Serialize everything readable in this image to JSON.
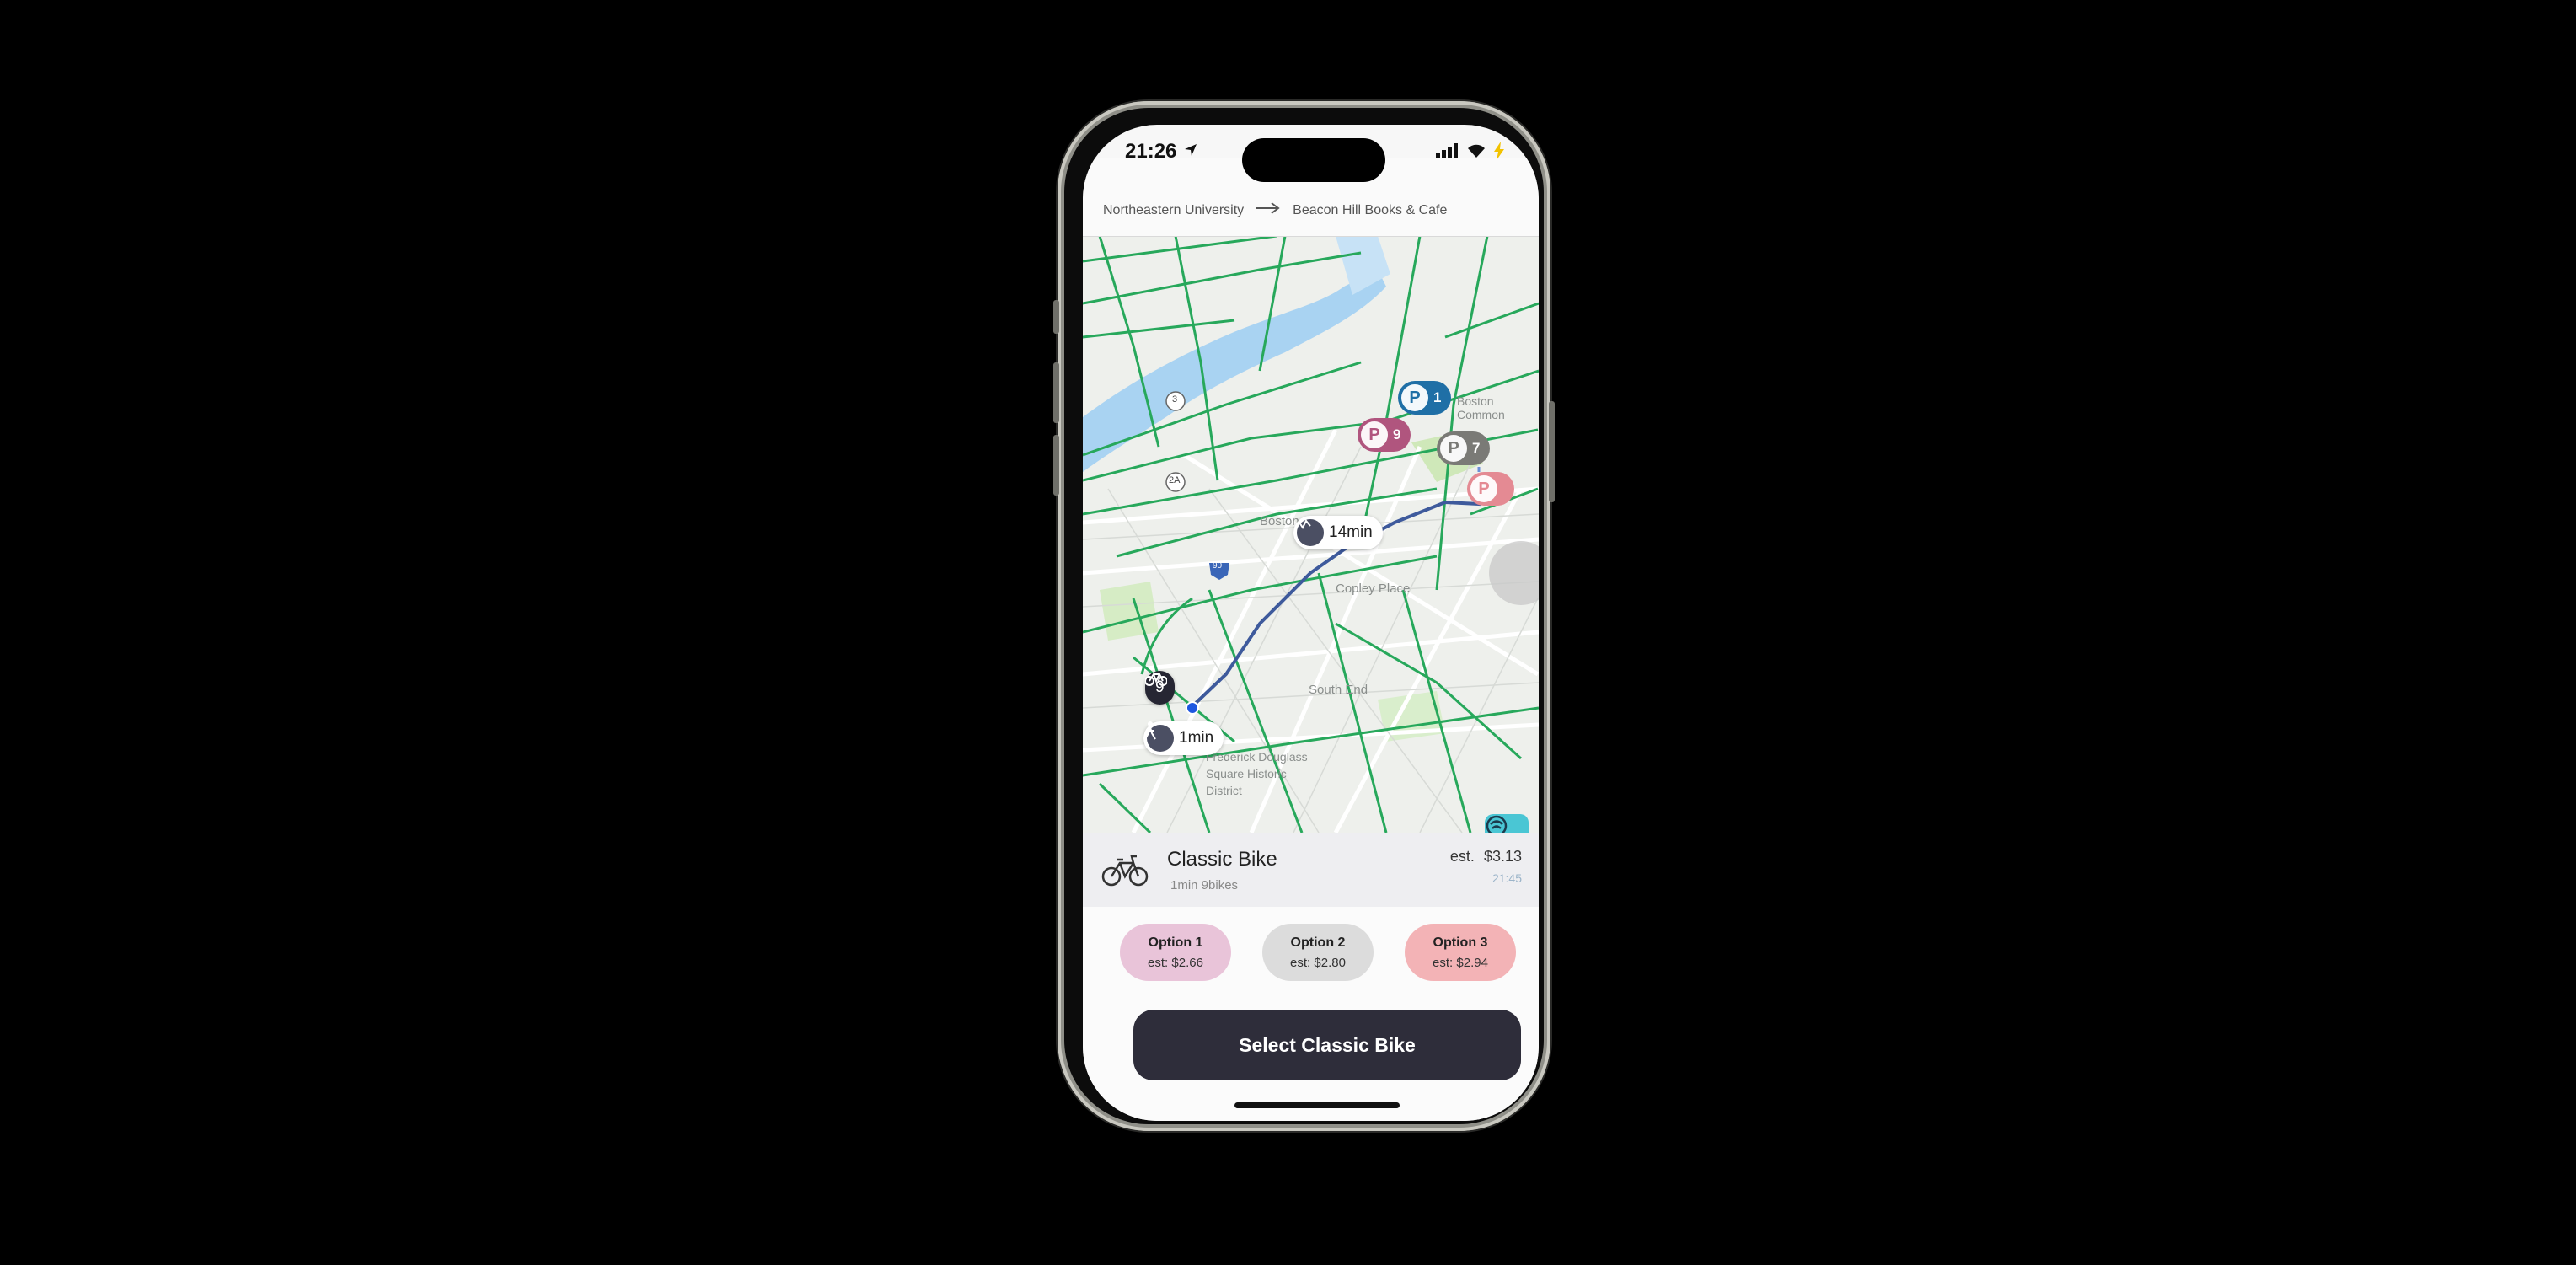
{
  "status": {
    "time": "21:26"
  },
  "route": {
    "from": "Northeastern University",
    "to": "Beacon Hill Books & Cafe"
  },
  "map": {
    "labels": {
      "boston": "Boston",
      "copley": "Copley Place",
      "south_end": "South End",
      "frederick": "Frederick Douglass Square Historic District",
      "highway_3": "3",
      "highway_2a": "2A",
      "highway_90": "90",
      "boston_common": "Boston Common"
    },
    "bike_time": "14min",
    "walk_time": "1min",
    "station_count": "9",
    "parking": [
      {
        "count": "1",
        "color": "#1f6fa6"
      },
      {
        "count": "9",
        "color": "#b0557e"
      },
      {
        "count": "7",
        "color": "#7a7a76"
      },
      {
        "count": "",
        "color": "#e48a93"
      }
    ]
  },
  "vehicle": {
    "name": "Classic Bike",
    "sub": "1min 9bikes",
    "est_label": "est.",
    "est_price": "$3.13",
    "time": "21:45"
  },
  "options": [
    {
      "title": "Option 1",
      "price": "est: $2.66",
      "color": "#e9c4d9"
    },
    {
      "title": "Option 2",
      "price": "est: $2.80",
      "color": "#dcdcdc"
    },
    {
      "title": "Option 3",
      "price": "est: $2.94",
      "color": "#f3b3b6"
    }
  ],
  "select_label": "Select Classic Bike",
  "colors": {
    "accent": "#2e2d3a",
    "route": "#3e5a9c",
    "bike_lanes": "#27a85b",
    "river": "#a9d3f2"
  }
}
